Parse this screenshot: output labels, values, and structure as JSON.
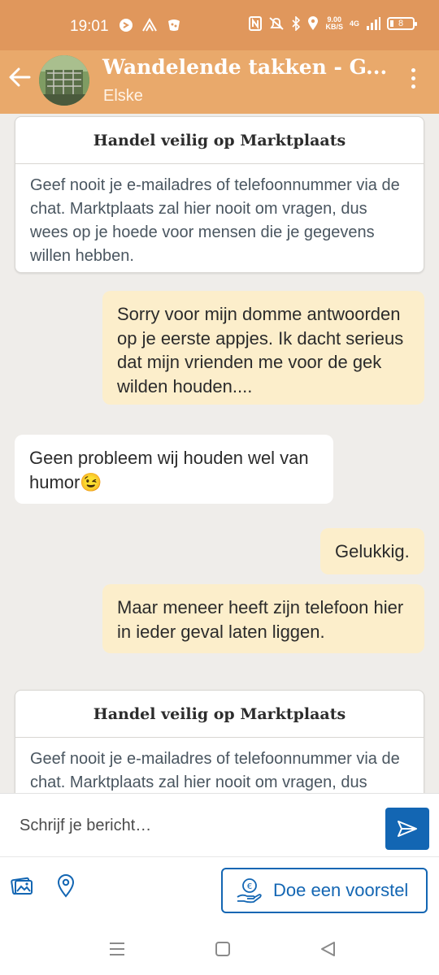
{
  "status_bar": {
    "time": "19:01",
    "net_speed_value": "9.00",
    "net_speed_unit": "KB/S",
    "network_type": "4G",
    "battery_level": "8"
  },
  "app_bar": {
    "title": "Wandelende takken - G...",
    "subtitle": "Elske"
  },
  "notices": [
    {
      "title": "Handel veilig op Marktplaats",
      "body": "Geef nooit je e-mailadres of telefoonnummer via de chat. Marktplaats zal hier nooit om vragen, dus wees op je hoede voor mensen die je gegevens willen hebben."
    },
    {
      "title": "Handel veilig op Marktplaats",
      "body": "Geef nooit je e-mailadres of telefoonnummer via de chat. Marktplaats zal hier nooit om vragen, dus"
    }
  ],
  "messages": [
    {
      "direction": "outgoing",
      "text": "Sorry voor mijn domme antwoorden op je eerste appjes. Ik dacht serieus dat mijn vrienden me voor de gek wilden houden...."
    },
    {
      "direction": "incoming",
      "text": "Geen probleem wij houden wel van humor😉"
    },
    {
      "direction": "outgoing",
      "text": "Gelukkig."
    },
    {
      "direction": "outgoing",
      "text": "Maar meneer heeft zijn telefoon hier in ieder geval laten liggen."
    }
  ],
  "composer": {
    "placeholder": "Schrijf je bericht…"
  },
  "actions": {
    "offer_label": "Doe een voorstel"
  },
  "colors": {
    "status_bar": "#e0975c",
    "app_bar": "#e9a96b",
    "outgoing_bubble": "#fceecb",
    "incoming_bubble": "#ffffff",
    "accent_blue": "#1366b3",
    "chat_background": "#efedea"
  },
  "icons": {
    "back": "arrow-left-icon",
    "menu": "more-vertical-icon",
    "send": "send-icon",
    "photos": "photos-icon",
    "location": "location-pin-icon",
    "offer": "euro-hand-icon"
  }
}
